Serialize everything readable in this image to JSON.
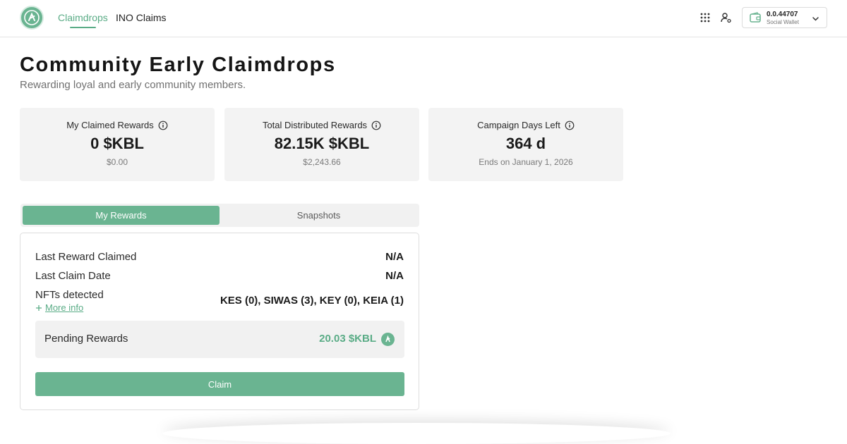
{
  "header": {
    "nav": [
      {
        "label": "Claimdrops",
        "active": true
      },
      {
        "label": "INO Claims",
        "active": false
      }
    ],
    "icons": [
      "apps-grid-icon",
      "user-settings-icon"
    ],
    "wallet": {
      "amount": "0.0.44707",
      "label": "Social Wallet"
    }
  },
  "page": {
    "title": "Community Early Claimdrops",
    "subtitle": "Rewarding loyal and early community members."
  },
  "stats": [
    {
      "label": "My Claimed Rewards",
      "value": "0 $KBL",
      "sub": "$0.00"
    },
    {
      "label": "Total Distributed Rewards",
      "value": "82.15K $KBL",
      "sub": "$2,243.66"
    },
    {
      "label": "Campaign Days Left",
      "value": "364 d",
      "sub": "Ends on January 1, 2026"
    }
  ],
  "tabs": [
    {
      "label": "My Rewards",
      "active": true
    },
    {
      "label": "Snapshots",
      "active": false
    }
  ],
  "rewards": {
    "last_reward_label": "Last Reward Claimed",
    "last_reward_value": "N/A",
    "last_claim_label": "Last Claim Date",
    "last_claim_value": "N/A",
    "nfts_label": "NFTs detected",
    "nfts_value": "KES (0), SIWAS (3), KEY (0), KEIA (1)",
    "more_info": "More info",
    "pending_label": "Pending Rewards",
    "pending_value": "20.03 $KBL",
    "claim_label": "Claim"
  },
  "colors": {
    "accent": "#6ab491",
    "accent_text": "#5aac86",
    "card_bg": "#f3f3f3"
  }
}
